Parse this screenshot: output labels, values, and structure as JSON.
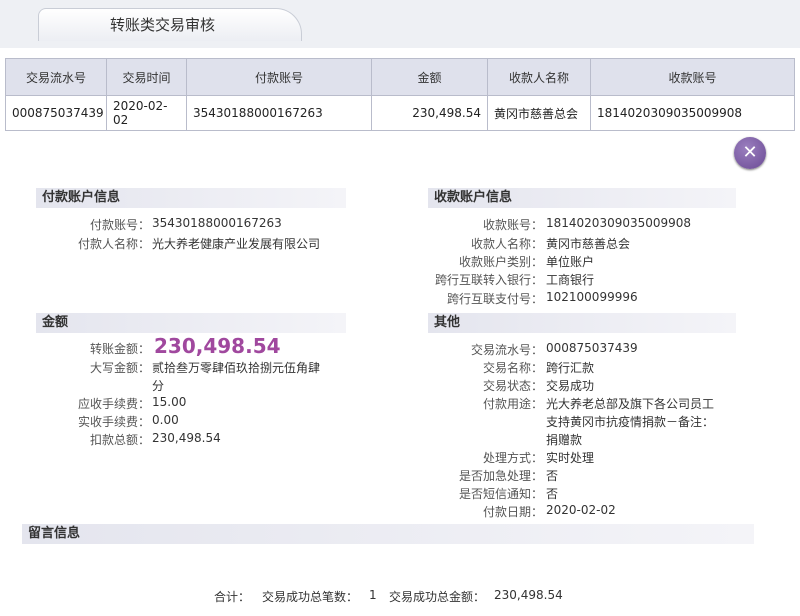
{
  "header": {
    "tab_title": "转账类交易审核"
  },
  "grid": {
    "columns": [
      "交易流水号",
      "交易时间",
      "付款账号",
      "金额",
      "收款人名称",
      "收款账号"
    ],
    "row": [
      "000875037439",
      "2020-02-02",
      "35430188000167263",
      "230,498.54",
      "黄冈市慈善总会",
      "1814020309035009908"
    ]
  },
  "close_icon": "close-icon",
  "payer": {
    "title": "付款账户信息",
    "account_label": "付款账号：",
    "account": "35430188000167263",
    "name_label": "付款人名称：",
    "name": "光大养老健康产业发展有限公司"
  },
  "payee": {
    "title": "收款账户信息",
    "account_label": "收款账号：",
    "account": "1814020309035009908",
    "name_label": "收款人名称：",
    "name": "黄冈市慈善总会",
    "type_label": "收款账户类别：",
    "type": "单位账户",
    "bank_label": "跨行互联转入银行：",
    "bank": "工商银行",
    "payno_label": "跨行互联支付号：",
    "payno": "102100099996"
  },
  "amount": {
    "title": "金额",
    "transfer_label": "转账金额：",
    "transfer": "230,498.54",
    "upper_label": "大写金额：",
    "upper_line1": "贰拾叁万零肆佰玖拾捌元伍角肆",
    "upper_line2": "分",
    "fee_due_label": "应收手续费：",
    "fee_due": "15.00",
    "fee_paid_label": "实收手续费：",
    "fee_paid": "0.00",
    "total_label": "扣款总额：",
    "total": "230,498.54"
  },
  "other": {
    "title": "其他",
    "serial_label": "交易流水号：",
    "serial": "000875037439",
    "txname_label": "交易名称：",
    "txname": "跨行汇款",
    "status_label": "交易状态：",
    "status": "交易成功",
    "purpose_label": "付款用途：",
    "purpose_line1": "光大养老总部及旗下各公司员工",
    "purpose_line2": "支持黄冈市抗疫情捐款－备注：",
    "purpose_line3": "捐赠款",
    "method_label": "处理方式：",
    "method": "实时处理",
    "urgent_label": "是否加急处理：",
    "urgent": "否",
    "sms_label": "是否短信通知：",
    "sms": "否",
    "date_label": "付款日期：",
    "date": "2020-02-02"
  },
  "message": {
    "title": "留言信息"
  },
  "footer": {
    "total_label": "合计：",
    "count_label": "交易成功总笔数：",
    "count": "1",
    "sum_label": "交易成功总金额：",
    "sum": "230,498.54"
  }
}
